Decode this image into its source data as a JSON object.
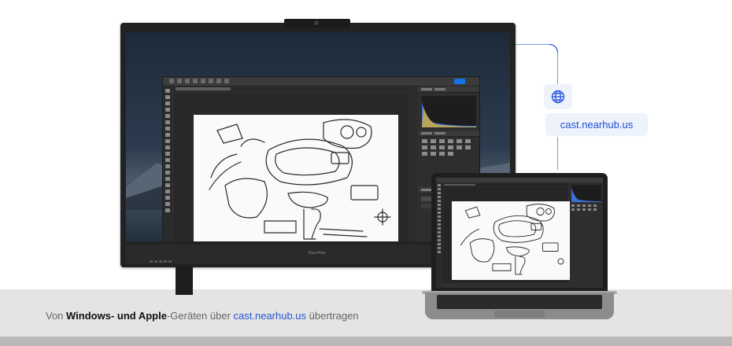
{
  "cast": {
    "url": "cast.nearhub.us",
    "icon": "globe-icon",
    "accent_color": "#2f5fe0",
    "chip_color": "#eef2fb"
  },
  "caption": {
    "prefix": "Von ",
    "bold": "Windows- und Apple",
    "middle": "-Geräten über ",
    "link": "cast.nearhub.us",
    "suffix": " übertragen"
  },
  "display": {
    "brand": "NearHub"
  },
  "app": {
    "name": "Photoshop",
    "share_color": "#1473e6",
    "canvas_content": "vr-headset-sketch"
  },
  "colors": {
    "floor": "#e4e4e4",
    "bezel": "#222222",
    "ps_bg": "#323232"
  }
}
